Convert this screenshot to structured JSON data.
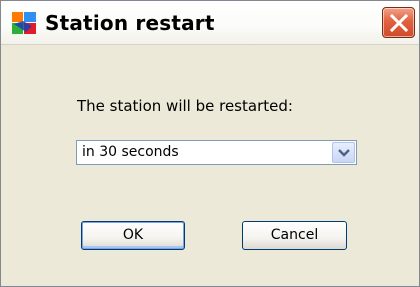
{
  "window": {
    "title": "Station restart",
    "icon": "avg-app-icon",
    "close_icon": "close-icon"
  },
  "dialog": {
    "prompt": "The station will be restarted:",
    "select": {
      "value": "in 30 seconds",
      "arrow_icon": "chevron-down-icon"
    },
    "buttons": {
      "ok_label": "OK",
      "cancel_label": "Cancel"
    }
  },
  "colors": {
    "dialog_bg": "#ece9d8",
    "close_button": "#e2623f",
    "button_border": "#003c74"
  }
}
